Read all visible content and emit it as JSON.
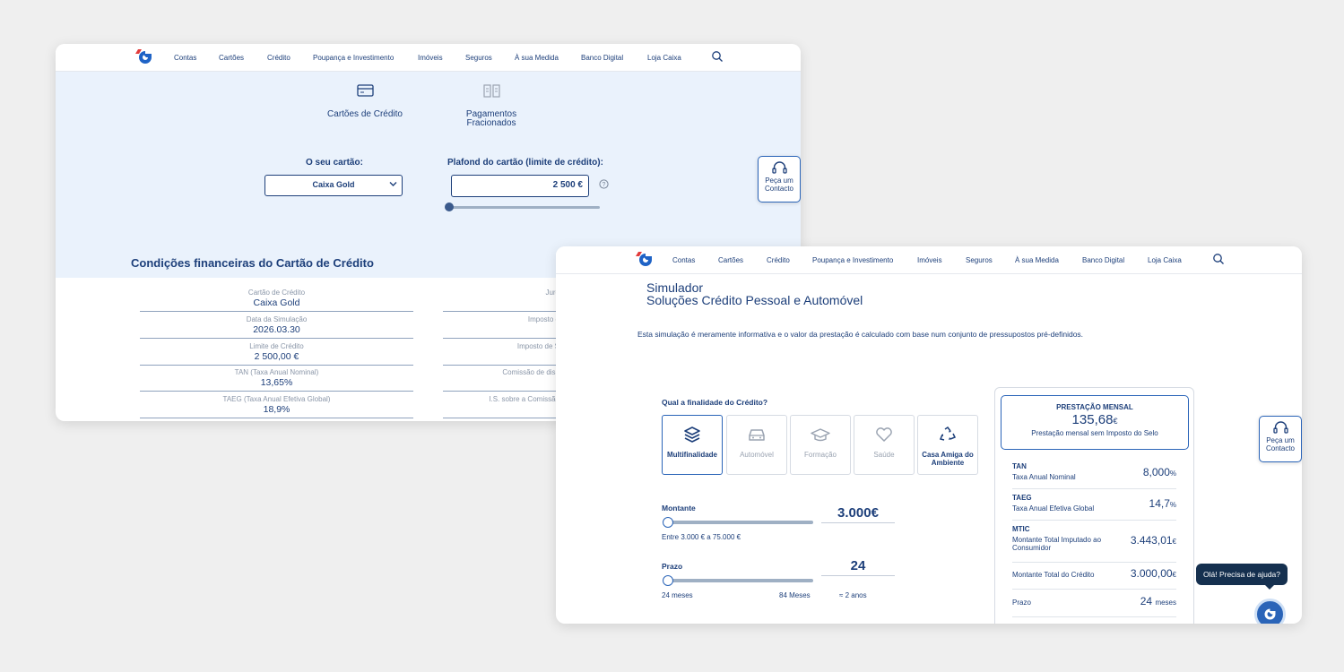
{
  "nav": {
    "items": [
      "Contas",
      "Cartões",
      "Crédito",
      "Poupança e Investimento",
      "Imóveis",
      "Seguros",
      "À sua Medida",
      "Banco Digital",
      "Loja Caixa"
    ]
  },
  "card_simulator": {
    "tabs": [
      {
        "label": "Cartões de Crédito",
        "icon": "credit-card-icon",
        "active": true
      },
      {
        "label_line1": "Pagamentos",
        "label_line2": "Fracionados",
        "icon": "split-payment-icon",
        "active": false
      }
    ],
    "card_label": "O seu cartão:",
    "card_value": "Caixa Gold",
    "limit_label": "Plafond do cartão (limite de crédito):",
    "limit_value": "2 500 €",
    "limit_slider_position": 0,
    "contact": {
      "line1": "Peça um",
      "line2": "Contacto"
    },
    "conditions_title": "Condições financeiras do Cartão de Crédito",
    "conditions_left": [
      {
        "label": "Cartão de Crédito",
        "value": "Caixa Gold"
      },
      {
        "label": "Data da Simulação",
        "value": "2026.03.30"
      },
      {
        "label": "Limite de Crédito",
        "value": "2 500,00 €"
      },
      {
        "label": "TAN (Taxa Anual Nominal)",
        "value": "13,65%"
      },
      {
        "label": "TAEG (Taxa Anual Efetiva Global)",
        "value": "18,9%"
      }
    ],
    "conditions_right": [
      "Juro",
      "Imposto d",
      "Imposto de S",
      "Comissão de disp",
      "I.S. sobre a Comissão"
    ]
  },
  "loan_simulator": {
    "title_line1": "Simulador",
    "title_line2": "Soluções Crédito Pessoal e Automóvel",
    "note": "Esta simulação é meramente informativa e o valor da prestação é calculado com base num conjunto de pressupostos pré-definidos.",
    "purpose_question": "Qual a finalidade do Crédito?",
    "purposes": [
      {
        "label": "Multifinalidade",
        "icon": "layers-icon",
        "selected": true
      },
      {
        "label": "Automóvel",
        "icon": "car-icon",
        "selected": false
      },
      {
        "label": "Formação",
        "icon": "graduation-cap-icon",
        "selected": false
      },
      {
        "label": "Saúde",
        "icon": "heart-icon",
        "selected": false
      },
      {
        "label": "Casa Amiga do Ambiente",
        "icon": "recycle-icon",
        "selected": false
      }
    ],
    "amount": {
      "label": "Montante",
      "value": "3.000€",
      "range_note": "Entre 3.000 € a 75.000 €",
      "slider_position": 0
    },
    "term": {
      "label": "Prazo",
      "value": "24",
      "min_label": "24 meses",
      "max_label": "84 Meses",
      "approx": "≈ 2 anos",
      "slider_position": 0
    },
    "monthly": {
      "heading": "PRESTAÇÃO MENSAL",
      "value": "135,68",
      "currency": "€",
      "subtitle": "Prestação mensal sem Imposto do Selo"
    },
    "results": [
      {
        "key": "TAN",
        "desc": "Taxa Anual Nominal",
        "value": "8,000",
        "unit": "%"
      },
      {
        "key": "TAEG",
        "desc": "Taxa Anual Efetiva Global",
        "value": "14,7",
        "unit": "%"
      },
      {
        "key": "MTIC",
        "desc": "Montante Total Imputado ao Consumidor",
        "value": "3.443,01",
        "unit": "€"
      },
      {
        "key": "",
        "desc": "Montante Total do Crédito",
        "value": "3.000,00",
        "unit": "€"
      },
      {
        "key": "",
        "desc": "Prazo",
        "value": "24",
        "unit": "meses"
      }
    ],
    "chat_prompt": "Olá! Precisa de ajuda?"
  },
  "colors": {
    "brand_blue": "#1d3f7a",
    "accent_blue": "#2a64b8",
    "hero_bg": "#eaf2fc",
    "page_bg": "#efefef"
  }
}
